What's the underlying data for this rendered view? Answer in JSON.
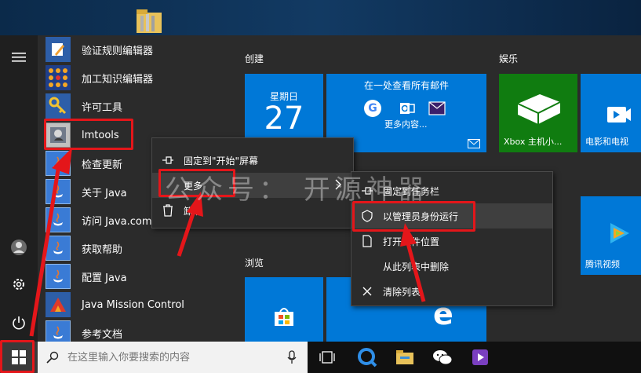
{
  "apps": [
    {
      "label": "验证规则编辑器",
      "icon": "rule-editor-icon"
    },
    {
      "label": "加工知识编辑器",
      "icon": "knowledge-editor-icon"
    },
    {
      "label": "许可工具",
      "icon": "license-key-icon"
    },
    {
      "label": "lmtools",
      "icon": "lmtools-icon"
    },
    {
      "label": "检查更新",
      "icon": "java-icon"
    },
    {
      "label": "关于 Java",
      "icon": "java-icon"
    },
    {
      "label": "访问 Java.com",
      "icon": "java-icon"
    },
    {
      "label": "获取帮助",
      "icon": "java-icon"
    },
    {
      "label": "配置 Java",
      "icon": "java-icon"
    },
    {
      "label": "Java Mission Control",
      "icon": "java-mission-control-icon"
    },
    {
      "label": "参考文档",
      "icon": "java-icon"
    }
  ],
  "groups": {
    "create": "创建",
    "entertainment": "娱乐",
    "browse": "浏览"
  },
  "tiles": {
    "calendar_day": "星期日",
    "calendar_date": "27",
    "mail_title": "在一处查看所有邮件",
    "mail_more": "更多内容...",
    "xbox": "Xbox 主机小...",
    "movies": "电影和电视",
    "tencent_video": "腾讯视频"
  },
  "context_menu_1": {
    "items": [
      "固定到\"开始\"屏幕",
      "更多",
      "卸载"
    ]
  },
  "context_menu_2": {
    "items": [
      "固定到任务栏",
      "以管理员身份运行",
      "打开文件位置",
      "从此列表中删除",
      "清除列表"
    ]
  },
  "taskbar": {
    "search_placeholder": "在这里输入你要搜索的内容"
  },
  "watermark": "公众号：  开源神器",
  "colors": {
    "tile_blue": "#0078d7",
    "xbox_green": "#107c10",
    "annotation_red": "#e4161a"
  }
}
